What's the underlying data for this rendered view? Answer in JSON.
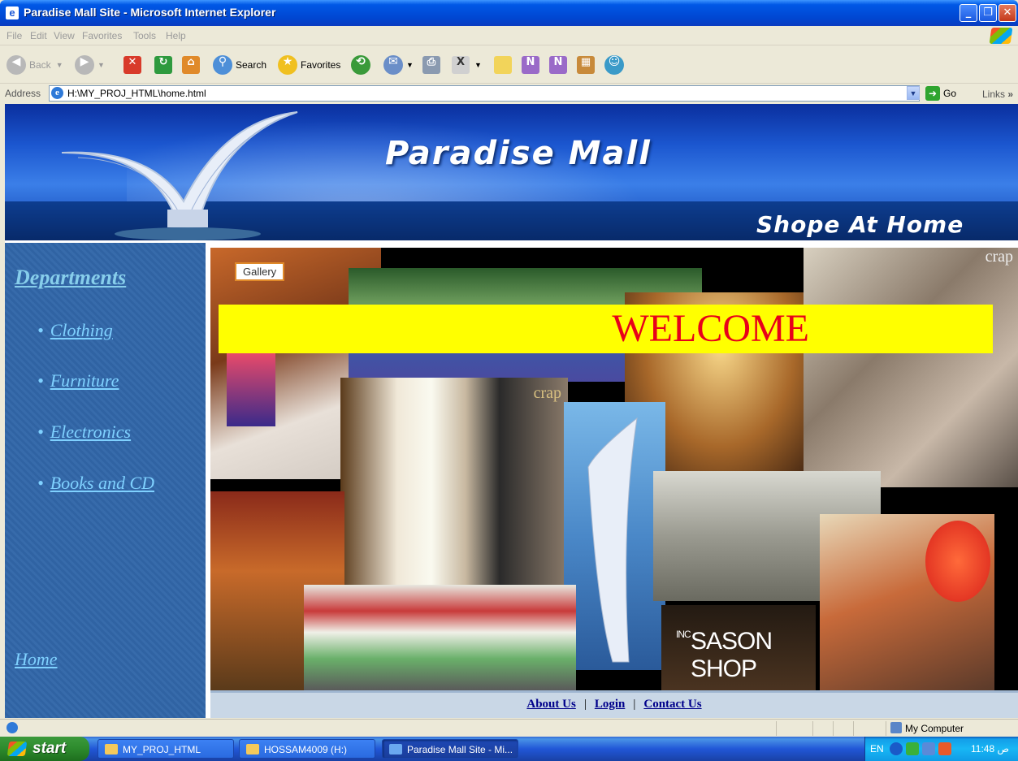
{
  "window": {
    "title": "Paradise Mall Site - Microsoft Internet Explorer",
    "controls": [
      "_",
      "❐",
      "✕"
    ]
  },
  "menubar": [
    "File",
    "Edit",
    "View",
    "Favorites",
    "Tools",
    "Help"
  ],
  "toolbar": {
    "back": "Back",
    "search": "Search",
    "favorites": "Favorites"
  },
  "address": {
    "label": "Address",
    "url": "H:\\MY_PROJ_HTML\\home.html",
    "go": "Go",
    "links": "Links",
    "links_chevron": "»"
  },
  "banner": {
    "title": "Paradise Mall",
    "tagline": "Shope At Home"
  },
  "sidebar": {
    "heading": "Departments",
    "items": [
      {
        "label": "Clothing"
      },
      {
        "label": "Furniture"
      },
      {
        "label": "Electronics"
      },
      {
        "label": "Books and CD"
      }
    ],
    "home": "Home"
  },
  "collage": {
    "welcome": "WELCOME",
    "sign_gallery": "Gallery",
    "sign_sason": "SASON SHOP",
    "sign_sason_suffix": "INC",
    "watermark": "crap"
  },
  "footer": {
    "links": [
      "About Us",
      "Login",
      "Contact Us"
    ],
    "separator": "|"
  },
  "statusbar": {
    "zone": "My Computer"
  },
  "taskbar": {
    "start": "start",
    "tasks": [
      "MY_PROJ_HTML",
      "HOSSAM4009 (H:)",
      "Paradise Mall Site - Mi..."
    ],
    "lang": "EN",
    "clock": "11:48 ص"
  },
  "colors": {
    "welcome_bg": "#ffff00",
    "welcome_text": "#e8001a",
    "sidebar_bg": "#3166a8",
    "sidebar_link": "#7fd1ff",
    "footer_link": "#00008b"
  }
}
